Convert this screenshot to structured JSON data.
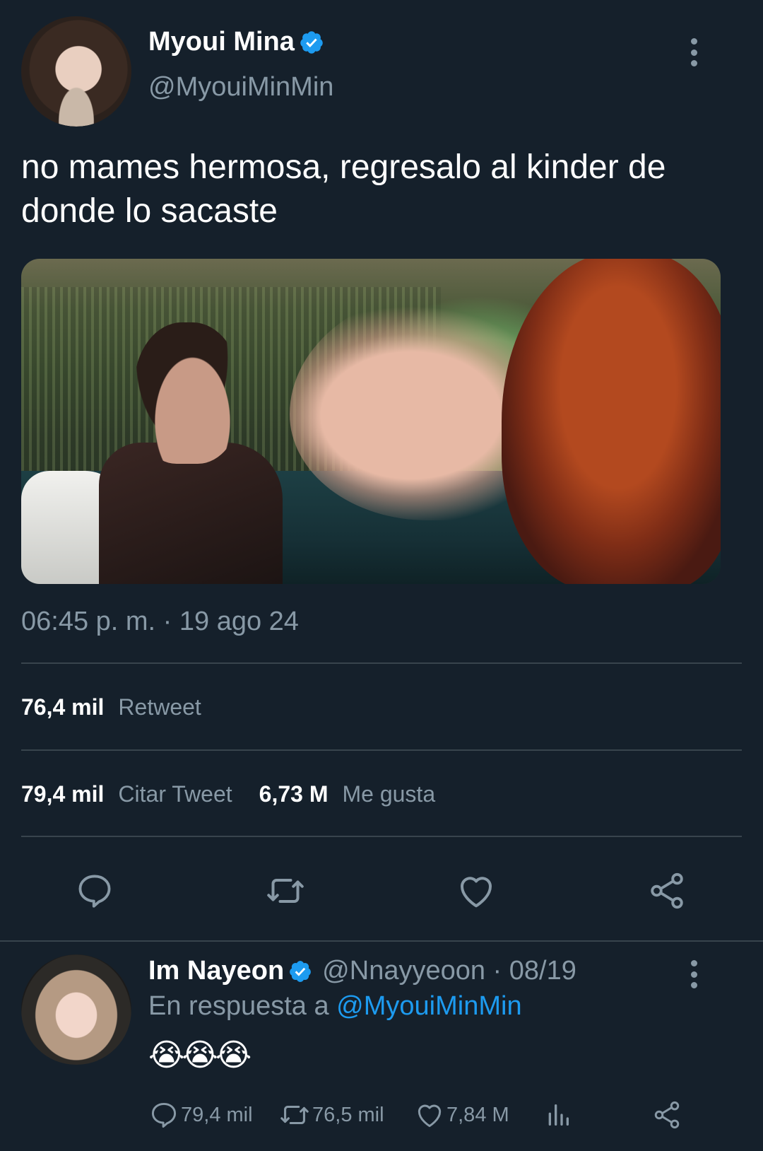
{
  "tweet": {
    "author_name": "Myoui Mina",
    "author_handle": "@MyouiMinMin",
    "text": "no mames hermosa, regresalo al kinder de donde lo sacaste",
    "timestamp": "06:45 p. m. · 19 ago 24",
    "retweets": {
      "count": "76,4 mil",
      "label": "Retweet"
    },
    "quotes": {
      "count": "79,4 mil",
      "label": "Citar Tweet"
    },
    "likes": {
      "count": "6,73 M",
      "label": "Me gusta"
    }
  },
  "reply": {
    "author_name": "Im Nayeon",
    "author_handle": "@Nnayyeoon · 08/19",
    "reply_prefix": "En respuesta a ",
    "reply_mention": "@MyouiMinMin",
    "emojis": "😭😭😭",
    "reply_count": "79,4 mil",
    "retweet_count": "76,5 mil",
    "like_count": "7,84 M"
  },
  "colors": {
    "background": "#15202b",
    "secondary_text": "#8899a6",
    "divider": "#38444d",
    "link": "#1d9bf0",
    "verified": "#1d9bf0"
  },
  "icons": [
    "verified-badge-icon",
    "more-vertical-icon",
    "reply-icon",
    "retweet-icon",
    "like-icon",
    "share-icon",
    "analytics-icon"
  ]
}
